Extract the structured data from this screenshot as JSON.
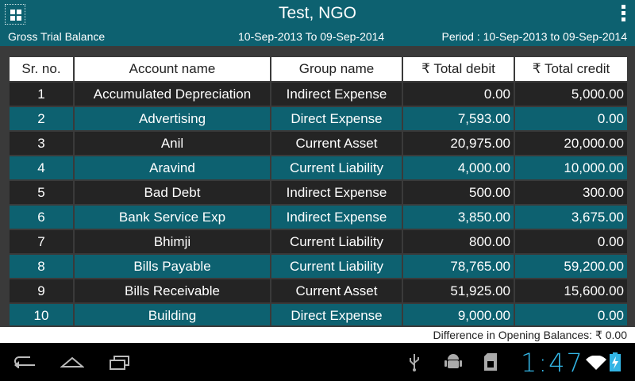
{
  "header": {
    "title": "Test, NGO",
    "report_name": "Gross Trial Balance",
    "date_range": "10-Sep-2013 To 09-Sep-2014",
    "period": "Period : 10-Sep-2013 to 09-Sep-2014"
  },
  "table": {
    "columns": [
      "Sr. no.",
      "Account name",
      "Group name",
      "₹ Total debit",
      "₹ Total credit"
    ],
    "rows": [
      [
        "1",
        "Accumulated Depreciation",
        "Indirect Expense",
        "0.00",
        "5,000.00"
      ],
      [
        "2",
        "Advertising",
        "Direct Expense",
        "7,593.00",
        "0.00"
      ],
      [
        "3",
        "Anil",
        "Current Asset",
        "20,975.00",
        "20,000.00"
      ],
      [
        "4",
        "Aravind",
        "Current Liability",
        "4,000.00",
        "10,000.00"
      ],
      [
        "5",
        "Bad Debt",
        "Indirect Expense",
        "500.00",
        "300.00"
      ],
      [
        "6",
        "Bank Service Exp",
        "Indirect Expense",
        "3,850.00",
        "3,675.00"
      ],
      [
        "7",
        "Bhimji",
        "Current Liability",
        "800.00",
        "0.00"
      ],
      [
        "8",
        "Bills Payable",
        "Current Liability",
        "78,765.00",
        "59,200.00"
      ],
      [
        "9",
        "Bills Receivable",
        "Current Asset",
        "51,925.00",
        "15,600.00"
      ],
      [
        "10",
        "Building",
        "Direct Expense",
        "9,000.00",
        "0.00"
      ]
    ]
  },
  "footer": {
    "difference_text": "Difference in Opening Balances: ₹ 0.00"
  },
  "system_bar": {
    "clock": "1:47",
    "icons": [
      "back-icon",
      "home-icon",
      "recent-apps-icon",
      "usb-icon",
      "android-debug-icon",
      "sd-card-icon",
      "wifi-icon",
      "battery-charging-icon"
    ]
  },
  "colors": {
    "header": "#0d6170",
    "row_dark": "#242424",
    "row_teal": "#0d6170",
    "background": "#3a3a3a",
    "clock": "#33b5e5"
  }
}
